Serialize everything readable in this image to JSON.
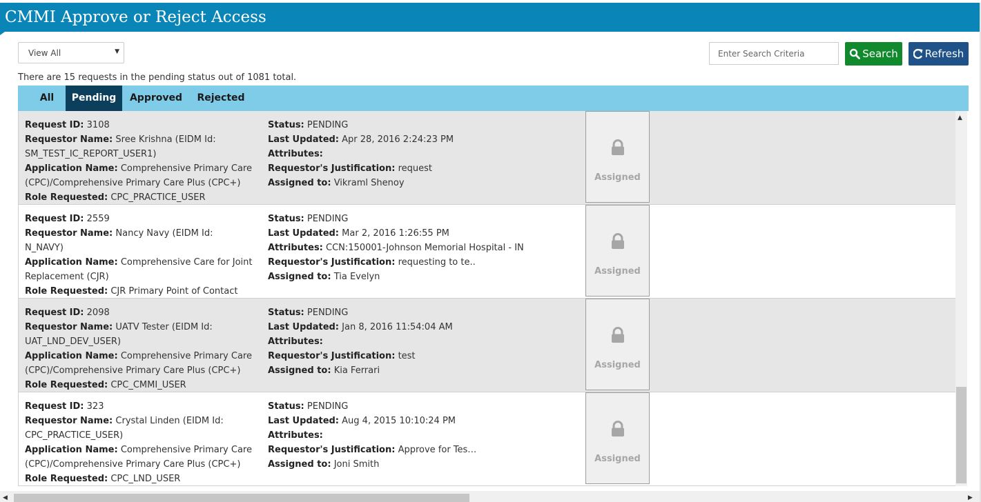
{
  "header": {
    "title": "CMMI Approve or Reject Access"
  },
  "toolbar": {
    "view_select": {
      "selected": "View All"
    },
    "search": {
      "placeholder": "Enter Search Criteria",
      "value": ""
    },
    "search_button": "Search",
    "refresh_button": "Refresh",
    "colors": {
      "search": "#118a2e",
      "refresh": "#1e5289",
      "header": "#0a85b8"
    }
  },
  "summary": "There are 15 requests in the pending status out of 1081 total.",
  "tabs": [
    {
      "label": "All",
      "active": false
    },
    {
      "label": "Pending",
      "active": true
    },
    {
      "label": "Approved",
      "active": false
    },
    {
      "label": "Rejected",
      "active": false
    }
  ],
  "labels": {
    "request_id": "Request ID:",
    "requestor_name": "Requestor Name:",
    "application_name": "Application Name:",
    "role_requested": "Role Requested:",
    "status": "Status:",
    "last_updated": "Last Updated:",
    "attributes": "Attributes:",
    "justification": "Requestor's Justification:",
    "assigned_to": "Assigned to:"
  },
  "requests": [
    {
      "request_id": "3108",
      "requestor_name": "Sree Krishna (EIDM Id: SM_TEST_IC_REPORT_USER1)",
      "application_name": "Comprehensive Primary Care (CPC)/Comprehensive Primary Care Plus (CPC+)",
      "role_requested": "CPC_PRACTICE_USER",
      "status": "PENDING",
      "last_updated": "Apr 28, 2016 2:24:23 PM",
      "attributes": "",
      "justification": "request",
      "assigned_to": "Vikraml Shenoy",
      "action_label": "Assigned",
      "action_icon": "lock-icon"
    },
    {
      "request_id": "2559",
      "requestor_name": "Nancy Navy (EIDM Id: N_NAVY)",
      "application_name": "Comprehensive Care for Joint Replacement (CJR)",
      "role_requested": "CJR Primary Point of Contact (PPOC)",
      "status": "PENDING",
      "last_updated": "Mar 2, 2016 1:26:55 PM",
      "attributes": " CCN:150001-Johnson Memorial Hospital - IN",
      "justification": "requesting to te..",
      "assigned_to": "Tia Evelyn",
      "action_label": "Assigned",
      "action_icon": "lock-icon"
    },
    {
      "request_id": "2098",
      "requestor_name": "UATV Tester (EIDM Id: UAT_LND_DEV_USER)",
      "application_name": "Comprehensive Primary Care (CPC)/Comprehensive Primary Care Plus (CPC+)",
      "role_requested": "CPC_CMMI_USER",
      "status": "PENDING",
      "last_updated": "Jan 8, 2016 11:54:04 AM",
      "attributes": "",
      "justification": "test",
      "assigned_to": "Kia Ferrari",
      "action_label": "Assigned",
      "action_icon": "lock-icon"
    },
    {
      "request_id": "323",
      "requestor_name": "Crystal Linden (EIDM Id: CPC_PRACTICE_USER)",
      "application_name": "Comprehensive Primary Care (CPC)/Comprehensive Primary Care Plus (CPC+)",
      "role_requested": "CPC_LND_USER",
      "status": "PENDING",
      "last_updated": "Aug 4, 2015 10:10:24 PM",
      "attributes": "",
      "justification": "Approve for Tes…",
      "assigned_to": "Joni Smith",
      "action_label": "Assigned",
      "action_icon": "lock-icon"
    }
  ]
}
